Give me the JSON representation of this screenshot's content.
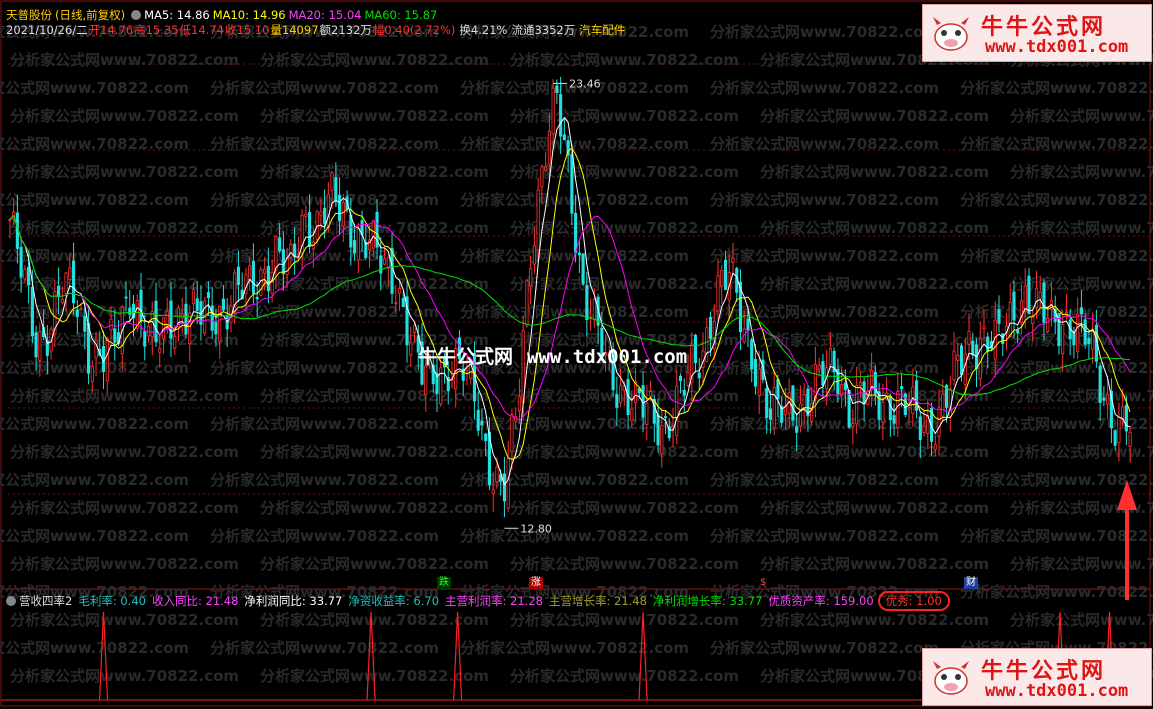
{
  "stock": {
    "name": "天普股份",
    "mode": "(日线,前复权)",
    "date": "2021/10/26/二",
    "open_label": "开",
    "open": "14.76",
    "high_label": "高",
    "high": "15.35",
    "low_label": "低",
    "low": "14.74",
    "close_label": "收",
    "close": "15.10",
    "vol_label": "量",
    "vol": "14097",
    "amt_label": "额",
    "amt": "2132万",
    "chg_label": "幅",
    "chg": "0.40(2.72%)",
    "turnover_label": "换",
    "turnover": "4.21%",
    "float_label": "流通",
    "float": "3352万",
    "sector": "汽车配件"
  },
  "ma": [
    {
      "label": "MA5: 14.86",
      "color": "#ffffff"
    },
    {
      "label": "MA10: 14.96",
      "color": "#ffff00"
    },
    {
      "label": "MA20: 15.04",
      "color": "#ff00ff"
    },
    {
      "label": "MA60: 15.87",
      "color": "#00e000"
    }
  ],
  "price": {
    "max_label": "23.46",
    "min_label": "12.80"
  },
  "markers": {
    "die": "跌",
    "zhang": "涨",
    "s": "$",
    "cai": "财"
  },
  "indicator": {
    "title": "营收四率2",
    "items": [
      {
        "label": "毛利率: 0.40",
        "color": "#20c0c0"
      },
      {
        "label": "收入同比: 21.48",
        "color": "#ff40ff"
      },
      {
        "label": "净利润同比: 33.77",
        "color": "#ffffff"
      },
      {
        "label": "净资收益率: 6.70",
        "color": "#20c0c0"
      },
      {
        "label": "主营利润率: 21.28",
        "color": "#ff40ff"
      },
      {
        "label": "主营增长率: 21.48",
        "color": "#a0a030"
      },
      {
        "label": "净利润增长率: 33.77",
        "color": "#00e000"
      },
      {
        "label": "优质资产率: 159.00",
        "color": "#ff40ff"
      },
      {
        "label": "优秀: 1.00",
        "color": "#ff3030"
      }
    ]
  },
  "logo": {
    "title": "牛牛公式网",
    "url": "www.tdx001.com"
  },
  "center_logo": {
    "title": "牛牛公式网",
    "url": "www.tdx001.com"
  },
  "watermark": "分析家公式网www.70822.com",
  "colors": {
    "up": "#ff3030",
    "down": "#20e0e0",
    "ma5": "#ffffff",
    "ma10": "#ffff00",
    "ma20": "#ff00ff",
    "ma60": "#00e000",
    "grid": "#7a1010",
    "signal": "#ff2020"
  },
  "chart_data": {
    "type": "candlestick",
    "price_path": [
      20.2,
      18.7,
      17.3,
      17.7,
      18.5,
      18.3,
      17.1,
      16.8,
      17.3,
      18.6,
      17.6,
      17.1,
      17.9,
      18.0,
      17.8,
      17.9,
      18.1,
      18.4,
      18.5,
      19.0,
      19.4,
      18.8,
      20.3,
      20.1,
      20.6,
      20.4,
      19.9,
      19.6,
      19.0,
      18.8,
      17.4,
      16.3,
      16.6,
      16.7,
      16.5,
      15.8,
      14.4,
      13.5,
      15.5,
      19.5,
      21.5,
      23.0,
      21.2,
      18.5,
      17.4,
      16.5,
      16.2,
      15.7,
      15.5,
      15.3,
      15.8,
      16.4,
      17.1,
      18.6,
      18.8,
      17.6,
      16.8,
      15.4,
      15.6,
      15.8,
      15.9,
      16.4,
      16.8,
      15.6,
      15.9,
      16.0,
      15.9,
      15.7,
      15.4,
      15.3,
      15.7,
      16.5,
      17.3,
      17.4,
      17.1,
      17.8,
      18.5,
      18.0,
      17.7,
      17.9,
      17.6,
      17.1,
      16.1,
      15.3,
      15.2
    ],
    "ohlc_latest": {
      "open": 14.76,
      "high": 15.35,
      "low": 14.74,
      "close": 15.1
    },
    "ma": {
      "MA5": 14.86,
      "MA10": 14.96,
      "MA20": 15.04,
      "MA60": 15.87
    },
    "extremes": {
      "high": 23.46,
      "low": 12.8
    },
    "signal_spikes_x": [
      0.085,
      0.323,
      0.4,
      0.565,
      0.936,
      0.98
    ]
  }
}
